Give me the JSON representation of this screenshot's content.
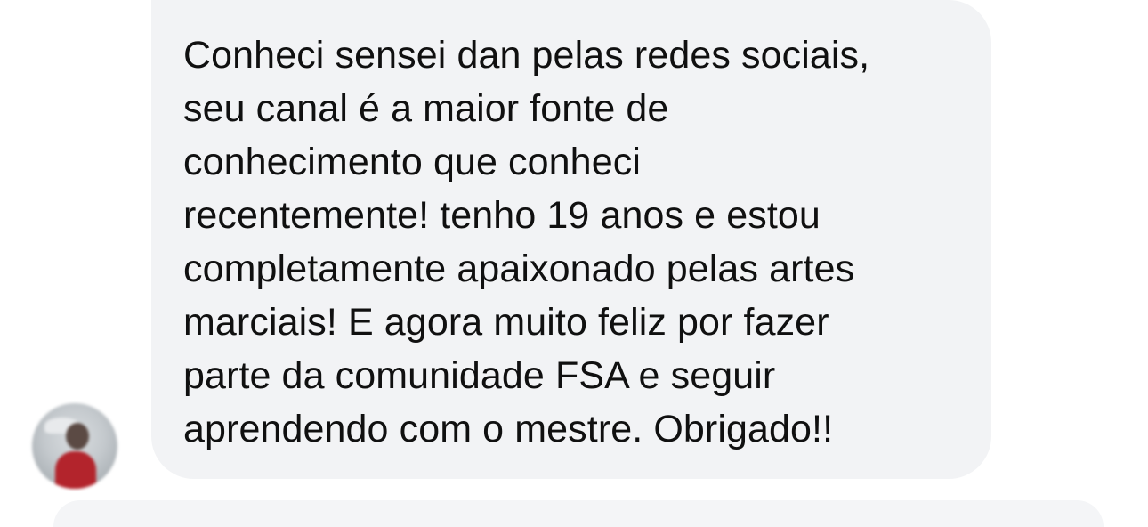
{
  "message": {
    "text": "Conheci sensei dan pelas redes sociais,\nseu canal é a maior fonte de\nconhecimento que conheci\nrecentemente! tenho 19 anos e estou\ncompletamente apaixonado pelas artes\nmarciais! E agora muito feliz por fazer\nparte da comunidade FSA e seguir\naprendendo com o mestre. Obrigado!!"
  },
  "colors": {
    "bubble": "#f2f3f5",
    "text": "#101010",
    "background": "#ffffff"
  }
}
